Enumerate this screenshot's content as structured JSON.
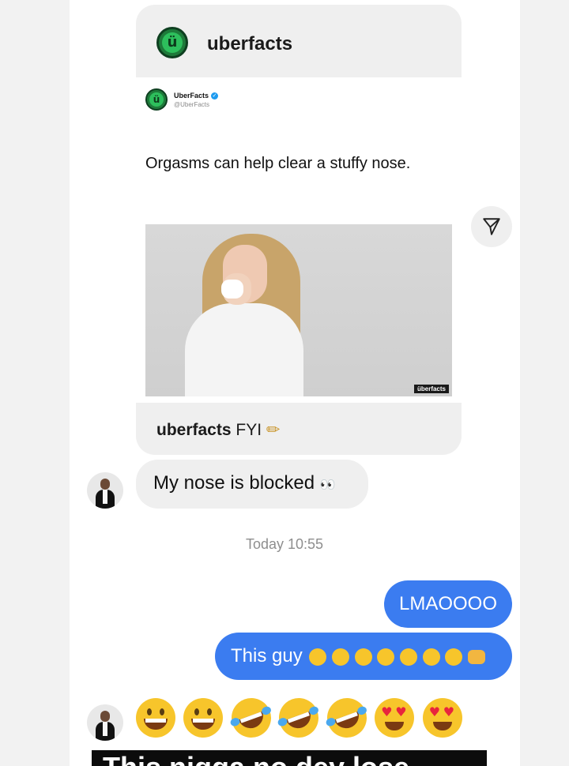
{
  "post": {
    "username": "uberfacts",
    "tweet": {
      "name": "UberFacts",
      "handle": "@UberFacts",
      "text": "Orgasms can help clear a stuffy nose.",
      "watermark": "überfacts"
    },
    "caption_user": "uberfacts",
    "caption_text": "FYI",
    "caption_emoji": "✏"
  },
  "messages": {
    "incoming_1": "My nose is blocked",
    "incoming_1_emoji": "👀",
    "timestamp": "Today 10:55",
    "outgoing_1": "LMAOOOO",
    "outgoing_2": "This guy"
  },
  "overlay_text": "This nigga no dey lose guard",
  "colors": {
    "outgoing_bubble": "#3b7cf0",
    "incoming_bubble": "#efefef",
    "uber_green": "#2dbf5c"
  }
}
